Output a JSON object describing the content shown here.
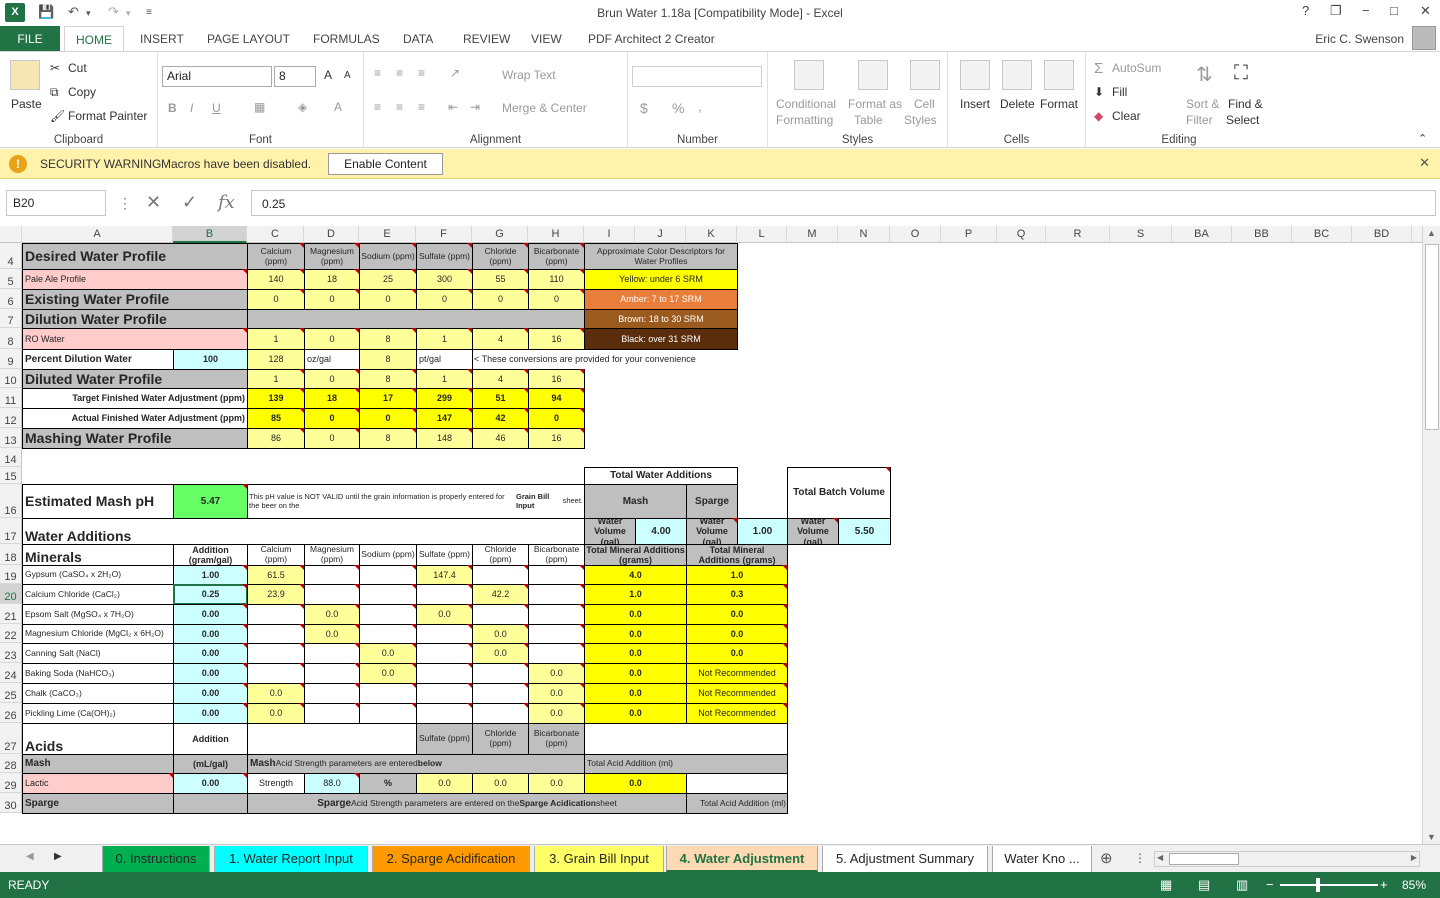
{
  "window": {
    "title": "Brun Water 1.18a  [Compatibility Mode] - Excel",
    "user": "Eric C. Swenson",
    "app_icon": "X"
  },
  "quickaccess": {
    "save": "save-icon",
    "undo": "undo-icon",
    "redo": "redo-icon"
  },
  "window_controls": {
    "help": "?",
    "restore": "❐",
    "minimize": "−",
    "maximize": "□",
    "close": "✕"
  },
  "ribbon_tabs": [
    "FILE",
    "HOME",
    "INSERT",
    "PAGE LAYOUT",
    "FORMULAS",
    "DATA",
    "REVIEW",
    "VIEW",
    "PDF Architect 2 Creator"
  ],
  "ribbon": {
    "clipboard": {
      "label": "Clipboard",
      "paste": "Paste",
      "cut": "Cut",
      "copy": "Copy",
      "format_painter": "Format Painter"
    },
    "font": {
      "label": "Font",
      "name": "Arial",
      "size": "8",
      "bold": "B",
      "italic": "I",
      "underline": "U"
    },
    "alignment": {
      "label": "Alignment",
      "wrap_text": "Wrap Text",
      "merge_center": "Merge & Center"
    },
    "number": {
      "label": "Number",
      "currency": "$",
      "percent": "%",
      "comma": ","
    },
    "styles": {
      "label": "Styles",
      "conditional": "Conditional",
      "conditional2": "Formatting",
      "format_as": "Format as",
      "format_as2": "Table",
      "cell_styles": "Cell",
      "cell_styles2": "Styles"
    },
    "cells": {
      "label": "Cells",
      "insert": "Insert",
      "delete": "Delete",
      "format": "Format"
    },
    "editing": {
      "label": "Editing",
      "autosum": "AutoSum",
      "fill": "Fill",
      "clear": "Clear",
      "sort": "Sort &",
      "sort2": "Filter",
      "find": "Find &",
      "find2": "Select"
    }
  },
  "security": {
    "title": "SECURITY WARNING",
    "message": "Macros have been disabled.",
    "button": "Enable Content"
  },
  "formula_bar": {
    "name_box": "B20",
    "value": "0.25",
    "fx": "fx"
  },
  "columns": [
    "A",
    "B",
    "C",
    "D",
    "E",
    "F",
    "G",
    "H",
    "I",
    "J",
    "K",
    "L",
    "M",
    "N",
    "O",
    "P",
    "Q",
    "R",
    "S",
    "BA",
    "BB",
    "BC",
    "BD"
  ],
  "rows": [
    "4",
    "5",
    "6",
    "7",
    "8",
    "9",
    "10",
    "11",
    "12",
    "13",
    "14",
    "15",
    "16",
    "17",
    "18",
    "19",
    "20",
    "21",
    "22",
    "23",
    "24",
    "25",
    "26",
    "27",
    "28",
    "29",
    "30"
  ],
  "ion_headers": [
    "Calcium (ppm)",
    "Magnesium (ppm)",
    "Sodium (ppm)",
    "Sulfate (ppm)",
    "Chloride (ppm)",
    "Bicarbonate (ppm)"
  ],
  "color_descriptors": {
    "title": "Approximate Color Descriptors for Water Profiles",
    "yellow": "Yellow: under 6 SRM",
    "amber": "Amber: 7 to 17 SRM",
    "brown": "Brown: 18 to 30 SRM",
    "black": "Black: over 31 SRM"
  },
  "profiles": {
    "desired": "Desired Water Profile",
    "pale": {
      "label": "Pale Ale Profile",
      "values": [
        "140",
        "18",
        "25",
        "300",
        "55",
        "110"
      ]
    },
    "existing": {
      "label": "Existing Water Profile",
      "values": [
        "0",
        "0",
        "0",
        "0",
        "0",
        "0"
      ]
    },
    "dilution": "Dilution Water Profile",
    "ro": {
      "label": "RO Water",
      "values": [
        "1",
        "0",
        "8",
        "1",
        "4",
        "16"
      ]
    },
    "percent": {
      "label": "Percent Dilution Water",
      "value": "100",
      "c": "128",
      "d": "oz/gal",
      "e": "8",
      "f": "pt/gal",
      "note": "< These conversions are provided for your convenience"
    },
    "diluted": {
      "label": "Diluted Water Profile",
      "values": [
        "1",
        "0",
        "8",
        "1",
        "4",
        "16"
      ]
    },
    "target": {
      "label": "Target Finished Water Adjustment (ppm)",
      "values": [
        "139",
        "18",
        "17",
        "299",
        "51",
        "94"
      ]
    },
    "actual": {
      "label": "Actual Finished Water Adjustment (ppm)",
      "values": [
        "85",
        "0",
        "0",
        "147",
        "42",
        "0"
      ]
    },
    "mashing": {
      "label": "Mashing Water Profile",
      "values": [
        "86",
        "0",
        "8",
        "148",
        "46",
        "16"
      ]
    }
  },
  "mash_ph": {
    "label": "Estimated Mash pH",
    "value": "5.47",
    "note1": "This pH value is NOT VALID until the grain information is properly entered for the beer on the",
    "note2": "Grain Bill Input",
    "note3": " sheet."
  },
  "totals": {
    "total_water": "Total Water Additions",
    "mash": "Mash",
    "sparge": "Sparge",
    "batch": "Total Batch Volume",
    "wv": "Water Volume (gal)",
    "mash_vol": "4.00",
    "sparge_vol": "1.00",
    "batch_vol": "5.50",
    "tma": "Total Mineral Additions (grams)"
  },
  "water_additions": "Water Additions",
  "minerals": {
    "label": "Minerals",
    "addition": "Addition (gram/gal)",
    "rows": [
      {
        "name": "Gypsum (CaSO₄ x 2H₂O)",
        "add": "1.00",
        "c": "61.5",
        "d": "",
        "e": "",
        "f": "147.4",
        "g": "",
        "h": "",
        "mash": "4.0",
        "sparge": "1.0"
      },
      {
        "name": "Calcium Chloride (CaCl₂)",
        "add": "0.25",
        "c": "23.9",
        "d": "",
        "e": "",
        "f": "",
        "g": "42.2",
        "h": "",
        "mash": "1.0",
        "sparge": "0.3"
      },
      {
        "name": "Epsom Salt (MgSO₄ x 7H₂O)",
        "add": "0.00",
        "c": "",
        "d": "0.0",
        "e": "",
        "f": "0.0",
        "g": "",
        "h": "",
        "mash": "0.0",
        "sparge": "0.0"
      },
      {
        "name": "Magnesium Chloride (MgCl₂ x 6H₂O)",
        "add": "0.00",
        "c": "",
        "d": "0.0",
        "e": "",
        "f": "",
        "g": "0.0",
        "h": "",
        "mash": "0.0",
        "sparge": "0.0"
      },
      {
        "name": "Canning Salt (NaCl)",
        "add": "0.00",
        "c": "",
        "d": "",
        "e": "0.0",
        "f": "",
        "g": "0.0",
        "h": "",
        "mash": "0.0",
        "sparge": "0.0"
      },
      {
        "name": "Baking Soda (NaHCO₃)",
        "add": "0.00",
        "c": "",
        "d": "",
        "e": "0.0",
        "f": "",
        "g": "",
        "h": "0.0",
        "mash": "0.0",
        "sparge": "Not Recommended"
      },
      {
        "name": "Chalk (CaCO₃)",
        "add": "0.00",
        "c": "0.0",
        "d": "",
        "e": "",
        "f": "",
        "g": "",
        "h": "0.0",
        "mash": "0.0",
        "sparge": "Not Recommended"
      },
      {
        "name": "Pickling Lime (Ca(OH)₂)",
        "add": "0.00",
        "c": "0.0",
        "d": "",
        "e": "",
        "f": "",
        "g": "",
        "h": "0.0",
        "mash": "0.0",
        "sparge": "Not Recommended"
      }
    ]
  },
  "acids": {
    "label": "Acids",
    "addition": "Addition",
    "unit": "(mL/gal)",
    "sulfate": "Sulfate (ppm)",
    "chloride": "Chloride (ppm)",
    "bicarb": "Bicarbonate (ppm)",
    "mash": "Mash",
    "mash_note_b": "Mash",
    "mash_note": " Acid Strength parameters are entered ",
    "below": "below",
    "total_acid": "Total Acid Addition (ml)",
    "lactic": {
      "name": "Lactic",
      "add": "0.00",
      "strength": "Strength",
      "pct": "88.0",
      "pct_sign": "%",
      "f": "0.0",
      "g": "0.0",
      "h": "0.0",
      "total": "0.0"
    },
    "sparge": "Sparge",
    "sparge_note_b": "Sparge",
    "sparge_note": " Acid Strength parameters are entered on the ",
    "sparge_sheet": "Sparge Acidication",
    "sheet_word": " sheet",
    "total_acid2": "Total Acid Addition (ml)"
  },
  "sheet_tabs": [
    "0. Instructions",
    "1. Water Report Input",
    "2. Sparge Acidification",
    "3. Grain Bill Input",
    "4. Water Adjustment",
    "5. Adjustment Summary",
    "Water Kno ..."
  ],
  "status": {
    "ready": "READY",
    "zoom": "85%"
  },
  "colors": {
    "excel_green": "#217346",
    "pink": "#ffcccc",
    "light_yellow": "#ffff99",
    "yellow": "#ffff00",
    "cyan": "#ccffff",
    "grey": "#bfbfbf",
    "amber": "#e87e3a",
    "brown": "#9c5b1e",
    "black": "#5a2d0c",
    "green": "#66ff66"
  }
}
